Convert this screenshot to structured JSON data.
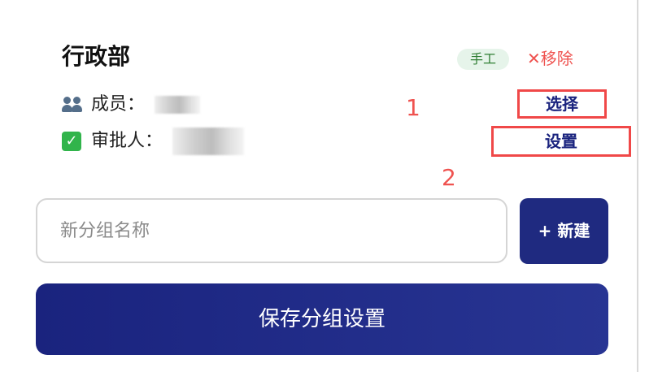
{
  "group": {
    "title": "行政部",
    "badge": "手工",
    "remove_label": "✕移除"
  },
  "members": {
    "icon": "people-icon",
    "label": "成员：",
    "select_label": "选择"
  },
  "approver": {
    "icon": "check-icon",
    "label": "审批人：",
    "set_label": "设置"
  },
  "annotations": {
    "step1": "1",
    "step2": "2"
  },
  "new_group": {
    "placeholder": "新分组名称",
    "value": "",
    "button_label": "+ 新建"
  },
  "save": {
    "label": "保存分组设置"
  },
  "colors": {
    "primary": "#1a237e",
    "danger": "#ef5350",
    "badge_bg": "#e6f4ea",
    "badge_text": "#2e7d32",
    "annotation": "#f04848"
  }
}
